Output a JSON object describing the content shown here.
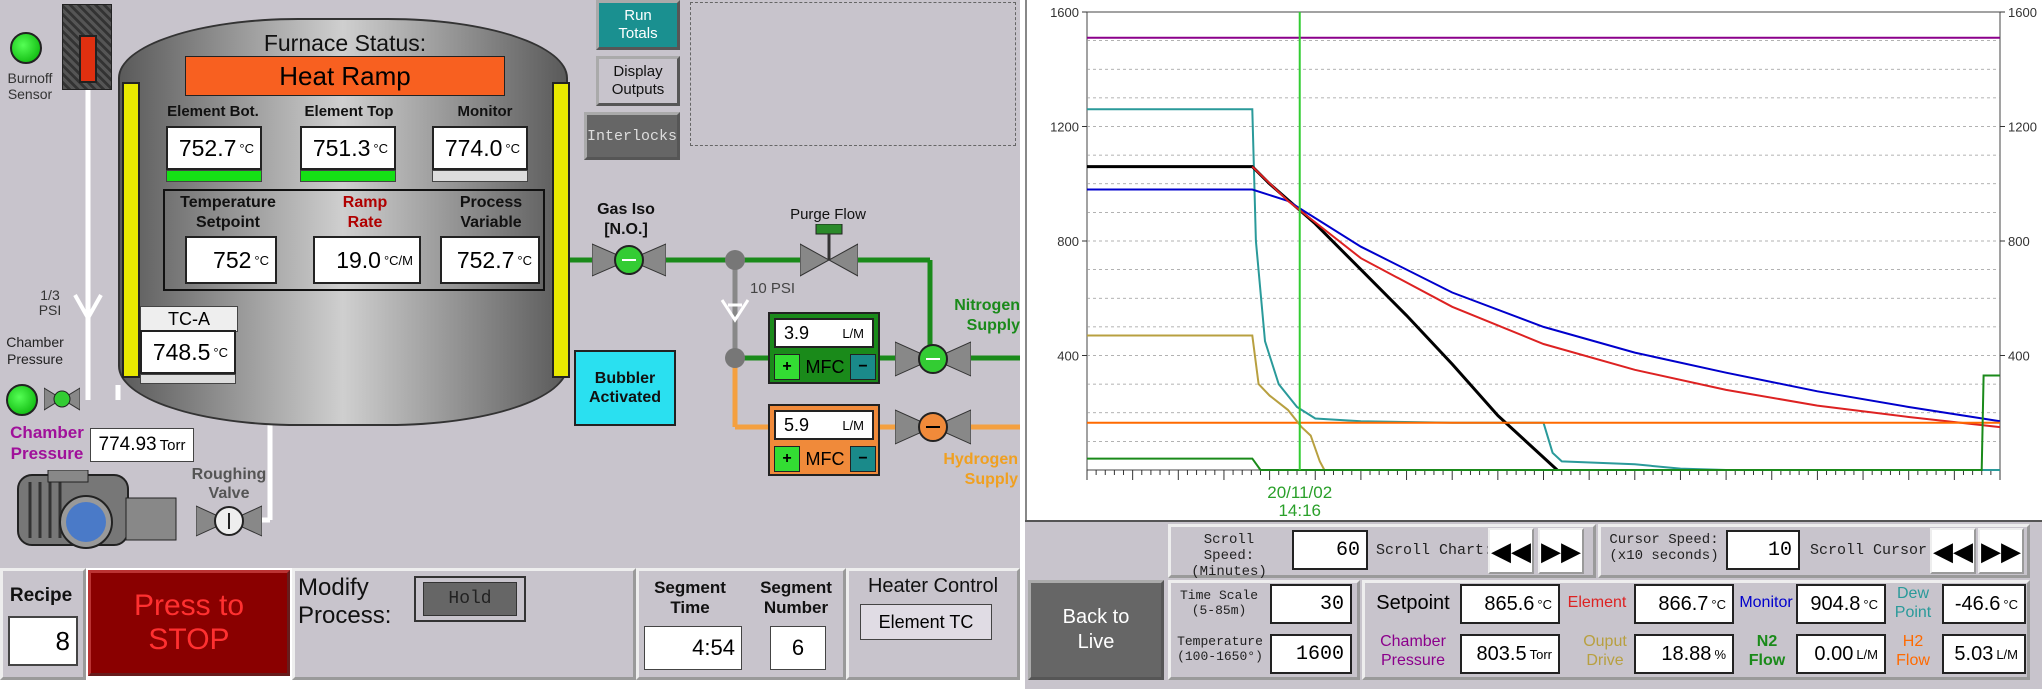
{
  "furnace": {
    "title": "Furnace Status:",
    "state": "Heat Ramp",
    "element_bot": {
      "label": "Element Bot.",
      "value": "752.7",
      "unit": "°C"
    },
    "element_top": {
      "label": "Element Top",
      "value": "751.3",
      "unit": "°C"
    },
    "monitor": {
      "label": "Monitor",
      "value": "774.0",
      "unit": "°C"
    },
    "temp_setpoint": {
      "label1": "Temperature",
      "label2": "Setpoint",
      "value": "752",
      "unit": "°C"
    },
    "ramp_rate": {
      "label1": "Ramp",
      "label2": "Rate",
      "value": "19.0",
      "unit": "°C/M"
    },
    "process_variable": {
      "label1": "Process",
      "label2": "Variable",
      "value": "752.7",
      "unit": "°C"
    },
    "tc": {
      "label": "TC-A",
      "value": "748.5",
      "unit": "°C"
    }
  },
  "left": {
    "burnoff_sensor": "Burnoff Sensor",
    "psi_label": "1/3 PSI",
    "chamber_pressure_small": "Chamber Pressure",
    "chamber_pressure_label": "Chamber Pressure",
    "chamber_pressure_value": "774.93",
    "chamber_pressure_unit": "Torr",
    "roughing_valve": "Roughing Valve"
  },
  "buttons": {
    "run_totals": "Run Totals",
    "display_outputs": "Display Outputs",
    "interlocks": "Interlocks",
    "bubbler": "Bubbler Activated"
  },
  "gas": {
    "gas_iso": "Gas Iso [N.O.]",
    "purge_flow": "Purge Flow",
    "psi10": "10 PSI",
    "nitrogen_supply": "Nitrogen Supply",
    "hydrogen_supply": "Hydrogen Supply",
    "mfc_n2": {
      "value": "3.9",
      "unit": "L/M",
      "label": "MFC",
      "plus": "+",
      "minus": "−"
    },
    "mfc_h2": {
      "value": "5.9",
      "unit": "L/M",
      "label": "MFC",
      "plus": "+",
      "minus": "−"
    }
  },
  "bottom_left": {
    "recipe_label": "Recipe",
    "recipe_value": "8",
    "stop_button": "Press to STOP",
    "modify_label": "Modify Process:",
    "hold_button": "Hold",
    "segment_time_label": "Segment Time",
    "segment_time_value": "4:54",
    "segment_number_label": "Segment Number",
    "segment_number_value": "6",
    "heater_control_label": "Heater Control",
    "heater_control_value": "Element TC"
  },
  "chart_data": {
    "type": "line",
    "yticks_left": [
      "1600",
      "1200",
      "800",
      "400"
    ],
    "yticks_right": [
      "1600",
      "1200",
      "800",
      "400"
    ],
    "ylim": [
      0,
      1600
    ],
    "xlim": [
      0,
      100
    ],
    "grid": true,
    "cursor_label": "20/11/02",
    "cursor_time": "14:16",
    "cursor_x": 23.3,
    "series": [
      {
        "color": "#8b008b",
        "x": [
          0,
          25,
          50,
          75,
          100
        ],
        "values": [
          1510,
          1510,
          1510,
          1510,
          1510
        ]
      },
      {
        "color": "#2a9a9a",
        "x": [
          0,
          18.1,
          18.5,
          19.5,
          21,
          23,
          25,
          30,
          40,
          50,
          51,
          52,
          60,
          65,
          70,
          80,
          100
        ],
        "values": [
          1260,
          1260,
          800,
          450,
          300,
          220,
          180,
          170,
          165,
          165,
          60,
          30,
          20,
          5,
          0,
          0,
          0
        ]
      },
      {
        "color": "#000000",
        "x": [
          0,
          18.1,
          20,
          25,
          30,
          35,
          40,
          45,
          51.5
        ],
        "values": [
          1060,
          1060,
          1000,
          860,
          700,
          540,
          370,
          190,
          0
        ]
      },
      {
        "color": "#0000cc",
        "x": [
          0,
          18.1,
          22,
          30,
          40,
          50,
          60,
          70,
          80,
          90,
          100
        ],
        "values": [
          980,
          980,
          940,
          780,
          620,
          500,
          410,
          340,
          275,
          220,
          170
        ]
      },
      {
        "color": "#dd2222",
        "x": [
          18.1,
          22,
          30,
          40,
          50,
          60,
          70,
          80,
          90,
          100
        ],
        "values": [
          1060,
          940,
          740,
          570,
          440,
          350,
          280,
          225,
          185,
          150
        ]
      },
      {
        "color": "#ff6a00",
        "x": [
          0,
          50,
          100
        ],
        "values": [
          165,
          165,
          165
        ]
      },
      {
        "color": "#b8a040",
        "x": [
          0,
          18.1,
          18.8,
          20,
          22,
          23.5,
          24.5,
          25.5,
          26
        ],
        "values": [
          470,
          470,
          300,
          260,
          210,
          150,
          120,
          30,
          0
        ]
      },
      {
        "color": "#1a8a1a",
        "x": [
          0,
          18.1,
          19,
          97.5,
          98,
          98.2,
          100
        ],
        "values": [
          40,
          40,
          0,
          0,
          0,
          330,
          330
        ]
      }
    ]
  },
  "chart_controls": {
    "scroll_speed_label": "Scroll Speed: (Minutes)",
    "scroll_speed_value": "60",
    "scroll_chart_label": "Scroll Chart:",
    "cursor_speed_label": "Cursor Speed: (x10 seconds)",
    "cursor_speed_value": "10",
    "scroll_cursor_label": "Scroll Cursor:",
    "back_to_live": "Back to Live",
    "time_scale_label": "Time Scale (5-85m)",
    "time_scale_value": "30",
    "temperature_label": "Temperature (100-1650°)",
    "temperature_value": "1600"
  },
  "readouts": {
    "setpoint": {
      "label": "Setpoint",
      "value": "865.6",
      "unit": "°C",
      "color": "#000000"
    },
    "element": {
      "label": "Element",
      "value": "866.7",
      "unit": "°C",
      "color": "#dd2222"
    },
    "monitor": {
      "label": "Monitor",
      "value": "904.8",
      "unit": "°C",
      "color": "#0000cc"
    },
    "dew_point": {
      "label": "Dew Point",
      "value": "-46.6",
      "unit": "°C",
      "color": "#2a9a9a"
    },
    "chamber_pressure": {
      "label": "Chamber Pressure",
      "value": "803.5",
      "unit": "Torr",
      "color": "#8b008b"
    },
    "output_drive": {
      "label": "Ouput Drive",
      "value": "18.88",
      "unit": "%",
      "color": "#b8a040"
    },
    "n2_flow": {
      "label": "N2 Flow",
      "value": "0.00",
      "unit": "L/M",
      "color": "#1a8a1a"
    },
    "h2_flow": {
      "label": "H2 Flow",
      "value": "5.03",
      "unit": "L/M",
      "color": "#ff6a00"
    }
  }
}
